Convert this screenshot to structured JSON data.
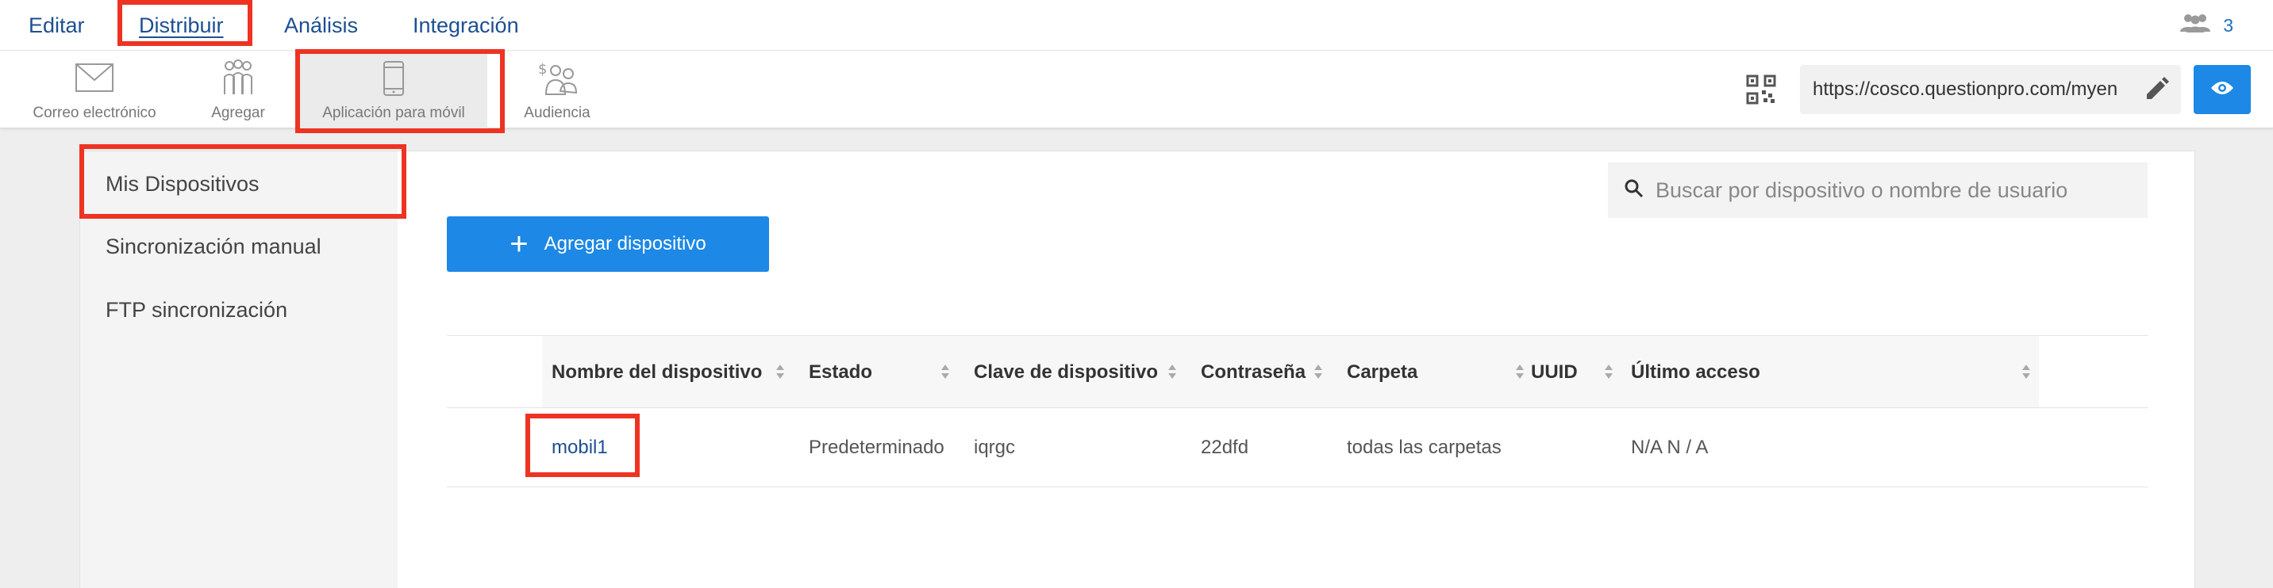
{
  "nav": {
    "tabs": [
      {
        "label": "Editar"
      },
      {
        "label": "Distribuir",
        "active": true
      },
      {
        "label": "Análisis"
      },
      {
        "label": "Integración"
      }
    ],
    "user_count": "3"
  },
  "toolbar": {
    "items": [
      {
        "label": "Correo electrónico",
        "icon": "envelope-icon"
      },
      {
        "label": "Agregar",
        "icon": "people-group-icon"
      },
      {
        "label": "Aplicación para móvil",
        "icon": "mobile-phone-icon",
        "active": true
      },
      {
        "label": "Audiencia",
        "icon": "audience-icon"
      }
    ],
    "survey_url": "https://cosco.questionpro.com/myen"
  },
  "sidebar": {
    "items": [
      {
        "label": "Mis Dispositivos",
        "active": true
      },
      {
        "label": "Sincronización manual"
      },
      {
        "label": "FTP sincronización"
      }
    ]
  },
  "main": {
    "search_placeholder": "Buscar por dispositivo o nombre de usuario",
    "add_button_label": "Agregar dispositivo"
  },
  "table": {
    "columns": [
      "Nombre del dispositivo",
      "Estado",
      "Clave de dispositivo",
      "Contraseña",
      "Carpeta",
      "UUID",
      "Último acceso"
    ],
    "rows": [
      {
        "device_name": "mobil1",
        "status": "Predeterminado",
        "device_key": "iqrgc",
        "password": "22dfd",
        "folder": "todas las carpetas",
        "uuid": "",
        "last_access": "N/A N / A"
      }
    ]
  },
  "colors": {
    "nav_text": "#1d4f91",
    "primary_button": "#1d88e5",
    "highlight_box": "#ee3322"
  }
}
